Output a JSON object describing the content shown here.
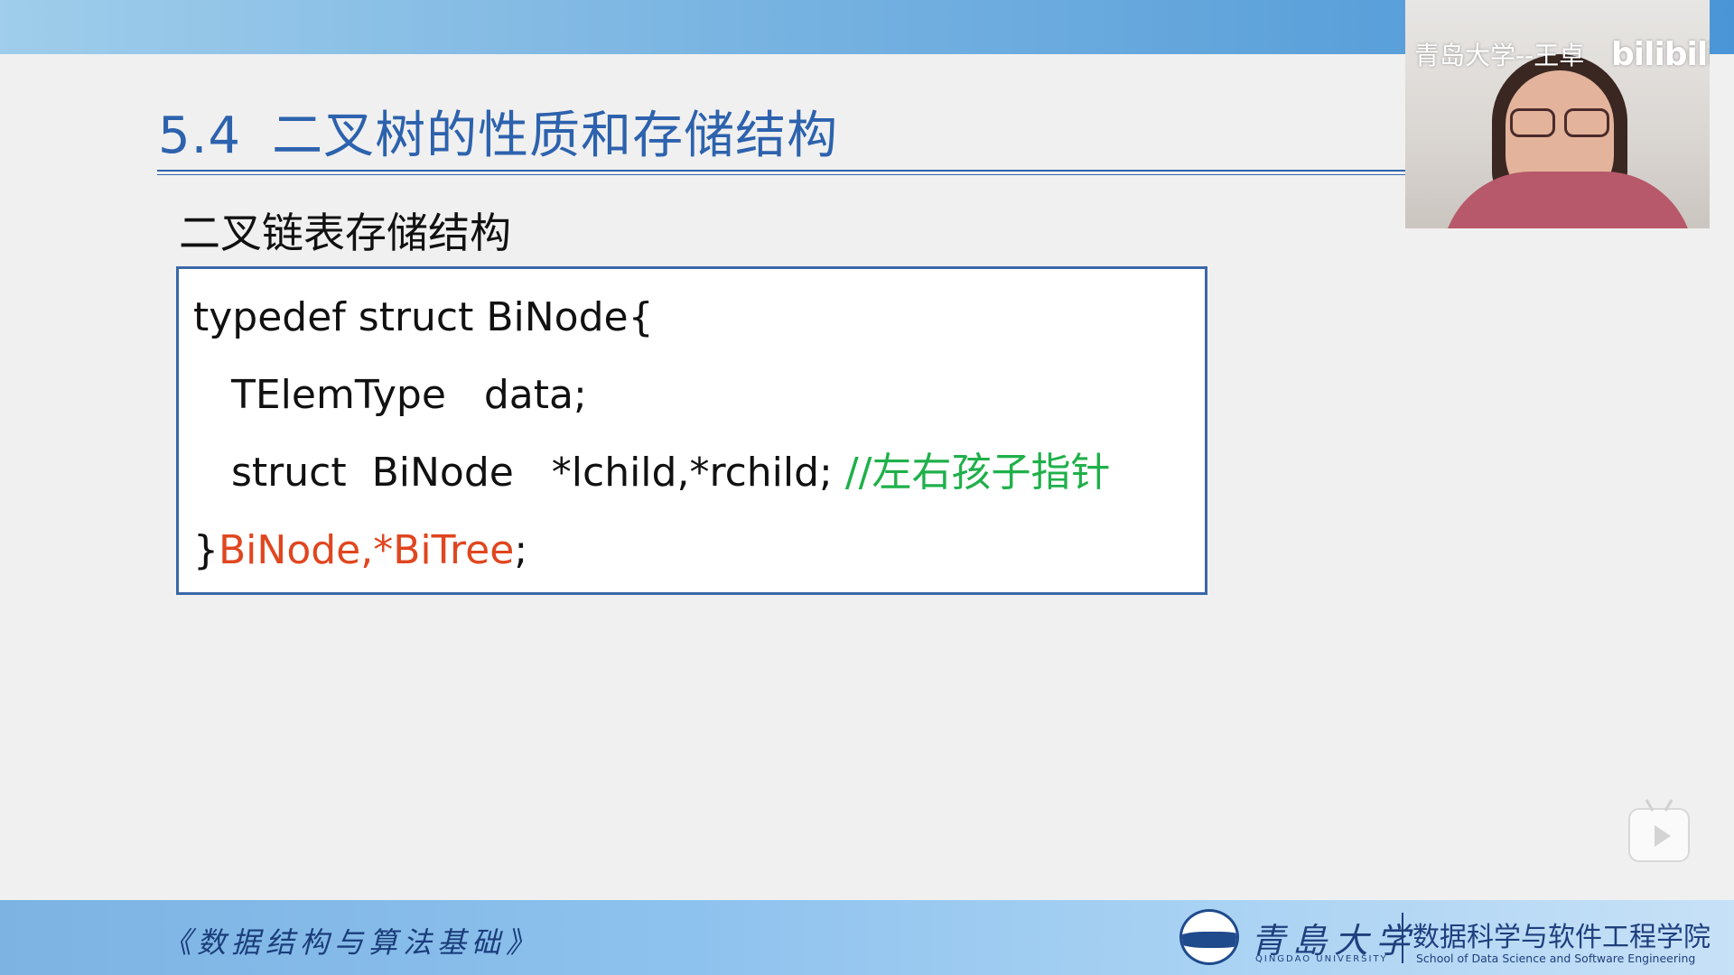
{
  "slide": {
    "title_number": "5.4",
    "title_text": "二叉树的性质和存储结构",
    "section_heading": "二叉链表存储结构"
  },
  "code": {
    "line1": "typedef struct BiNode{",
    "line2": "TElemType   data;",
    "line3_code": "struct  BiNode   *lchild,*rchild; ",
    "line3_comment": "//左右孩子指针",
    "line4_brace": "}",
    "line4_types": "BiNode,*BiTree",
    "line4_semicolon": ";"
  },
  "webcam": {
    "watermark": "青岛大学--王卓",
    "platform_logo": "bilibili"
  },
  "footer": {
    "course_title": "《数据结构与算法基础》",
    "university_cn": "青島大学",
    "university_en": "QINGDAO UNIVERSITY",
    "school_cn": "数据科学与软件工程学院",
    "school_en": "School of Data Science and Software Engineering"
  },
  "icons": {
    "play": "play-icon",
    "emblem": "university-emblem-icon"
  },
  "colors": {
    "title_blue": "#2d62ad",
    "comment_green": "#1fb04a",
    "type_red": "#e0461f",
    "box_border": "#3a67a8"
  }
}
